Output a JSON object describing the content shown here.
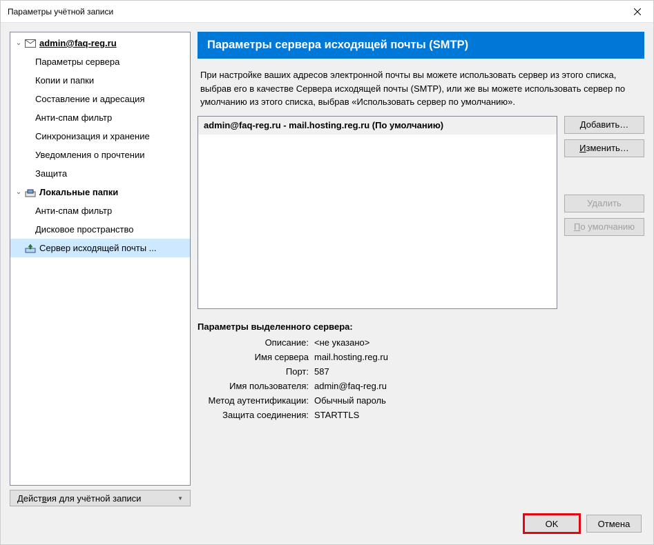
{
  "window": {
    "title": "Параметры учётной записи"
  },
  "tree": {
    "account": {
      "label": "admin@faq-reg.ru",
      "items": [
        "Параметры сервера",
        "Копии и папки",
        "Составление и адресация",
        "Анти-спам фильтр",
        "Синхронизация и хранение",
        "Уведомления о прочтении",
        "Защита"
      ]
    },
    "local": {
      "label": "Локальные папки",
      "items": [
        "Анти-спам фильтр",
        "Дисковое пространство"
      ]
    },
    "smtp": "Сервер исходящей почты ..."
  },
  "sidebar": {
    "account_actions": "Действия для учётной записи",
    "account_actions_underline_char": "в"
  },
  "content": {
    "header": "Параметры сервера исходящей почты (SMTP)",
    "description": "При настройке ваших адресов электронной почты вы можете использовать сервер из этого списка, выбрав его в качестве Сервера исходящей почты (SMTP), или же вы можете использовать сервер по умолчанию из этого списка, выбрав «Использовать сервер по умолчанию».",
    "list_entry": "admin@faq-reg.ru - mail.hosting.reg.ru (По умолчанию)",
    "buttons": {
      "add": "Добавить…",
      "add_u": "Д",
      "edit": "Изменить…",
      "edit_u": "И",
      "delete": "Удалить",
      "default": "По умолчанию",
      "default_u": "П"
    },
    "details": {
      "title": "Параметры выделенного сервера:",
      "rows": {
        "description_l": "Описание:",
        "description_v": "<не указано>",
        "server_l": "Имя сервера",
        "server_v": "mail.hosting.reg.ru",
        "port_l": "Порт:",
        "port_v": "587",
        "user_l": "Имя пользователя:",
        "user_v": "admin@faq-reg.ru",
        "auth_l": "Метод аутентификации:",
        "auth_v": "Обычный пароль",
        "sec_l": "Защита соединения:",
        "sec_v": "STARTTLS"
      }
    }
  },
  "footer": {
    "ok": "OK",
    "cancel": "Отмена"
  }
}
